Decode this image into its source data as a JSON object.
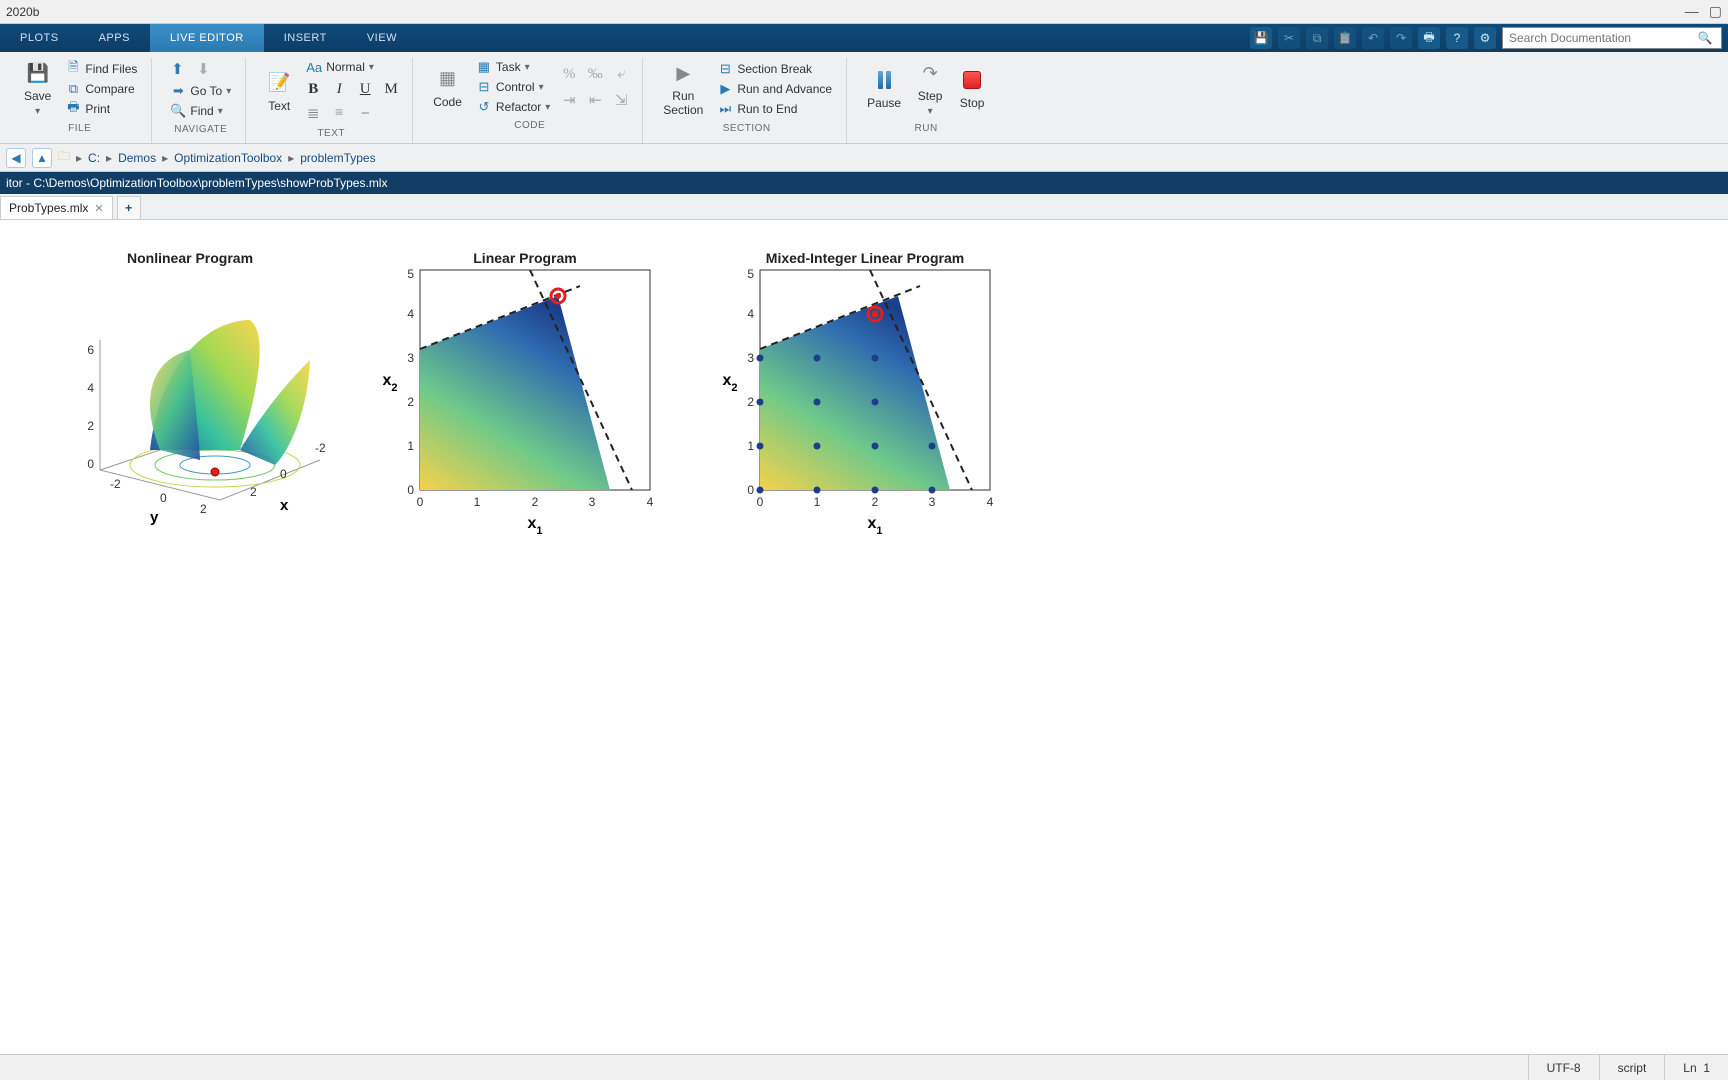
{
  "window": {
    "title": "2020b"
  },
  "tabs": {
    "plots": "PLOTS",
    "apps": "APPS",
    "liveeditor": "LIVE EDITOR",
    "insert": "INSERT",
    "view": "VIEW"
  },
  "search": {
    "placeholder": "Search Documentation"
  },
  "ribbon": {
    "file": {
      "save": "Save",
      "findfiles": "Find Files",
      "compare": "Compare",
      "print": "Print",
      "label": "FILE"
    },
    "navigate": {
      "goto": "Go To",
      "find": "Find",
      "label": "NAVIGATE"
    },
    "text": {
      "text": "Text",
      "normal": "Normal",
      "b": "B",
      "i": "I",
      "u": "U",
      "m": "M",
      "label": "TEXT"
    },
    "code": {
      "code": "Code",
      "task": "Task",
      "control": "Control",
      "refactor": "Refactor",
      "label": "CODE"
    },
    "section": {
      "runsection": "Run\nSection",
      "sectionbreak": "Section Break",
      "runadvance": "Run and Advance",
      "runtoend": "Run to End",
      "label": "SECTION"
    },
    "run": {
      "pause": "Pause",
      "step": "Step",
      "stop": "Stop",
      "label": "RUN"
    }
  },
  "path": {
    "drive": "C:",
    "p1": "Demos",
    "p2": "OptimizationToolbox",
    "p3": "problemTypes"
  },
  "editor": {
    "header": "itor - C:\\Demos\\OptimizationToolbox\\problemTypes\\showProbTypes.mlx",
    "tab": "ProbTypes.mlx"
  },
  "status": {
    "encoding": "UTF-8",
    "type": "script",
    "ln_label": "Ln",
    "ln_val": "1"
  },
  "chart_data": [
    {
      "type": "surface",
      "title": "Nonlinear Program",
      "xlabel": "x",
      "ylabel": "y",
      "xlim": [
        -2,
        2
      ],
      "ylim": [
        -2,
        2
      ],
      "zlim": [
        0,
        6
      ],
      "xticks": [
        -2,
        0,
        2
      ],
      "yticks": [
        -2,
        0,
        2
      ],
      "zticks": [
        0,
        2,
        4,
        6
      ],
      "note": "saddle-like surface with contour at base; red marker near (0.5,-0.8,0)"
    },
    {
      "type": "area",
      "title": "Linear Program",
      "xlabel": "x_1",
      "ylabel": "x_2",
      "xlim": [
        0,
        4
      ],
      "ylim": [
        0,
        5
      ],
      "xticks": [
        0,
        1,
        2,
        3,
        4
      ],
      "yticks": [
        0,
        1,
        2,
        3,
        4,
        5
      ],
      "feasible_polygon": [
        [
          0,
          0
        ],
        [
          0,
          3.2
        ],
        [
          2.4,
          4.4
        ],
        [
          3.3,
          0
        ]
      ],
      "constraint_lines": "dashed along upper-right boundaries",
      "optimum": {
        "x": 2.4,
        "y": 4.4
      }
    },
    {
      "type": "area",
      "title": "Mixed-Integer Linear Program",
      "xlabel": "x_1",
      "ylabel": "x_2",
      "xlim": [
        0,
        4
      ],
      "ylim": [
        0,
        5
      ],
      "xticks": [
        0,
        1,
        2,
        3,
        4
      ],
      "yticks": [
        0,
        1,
        2,
        3,
        4,
        5
      ],
      "feasible_polygon": [
        [
          0,
          0
        ],
        [
          0,
          3.2
        ],
        [
          2.4,
          4.4
        ],
        [
          3.3,
          0
        ]
      ],
      "integer_points": [
        [
          0,
          0
        ],
        [
          1,
          0
        ],
        [
          2,
          0
        ],
        [
          3,
          0
        ],
        [
          0,
          1
        ],
        [
          1,
          1
        ],
        [
          2,
          1
        ],
        [
          3,
          1
        ],
        [
          0,
          2
        ],
        [
          1,
          2
        ],
        [
          2,
          2
        ],
        [
          0,
          3
        ],
        [
          1,
          3
        ],
        [
          2,
          3
        ]
      ],
      "optimum": {
        "x": 2,
        "y": 4
      }
    }
  ]
}
